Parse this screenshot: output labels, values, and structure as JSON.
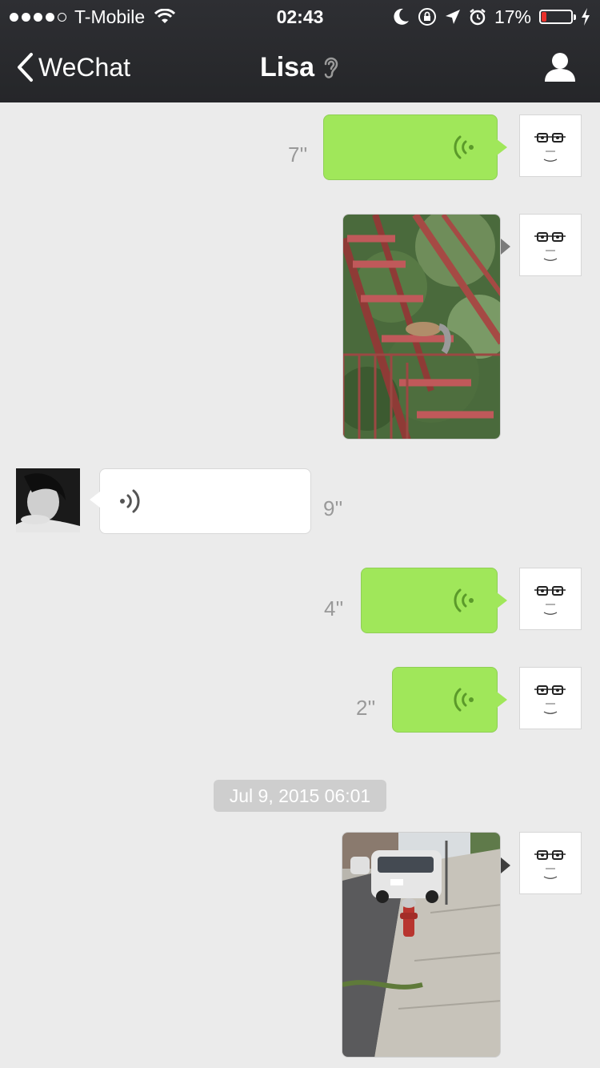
{
  "status_bar": {
    "carrier": "T-Mobile",
    "time": "02:43",
    "battery_percent": "17%",
    "battery_level": 0.17
  },
  "nav": {
    "back_label": "WeChat",
    "title": "Lisa"
  },
  "messages": [
    {
      "type": "voice",
      "sender": "me",
      "duration": "7''"
    },
    {
      "type": "image",
      "sender": "me",
      "image_icon": "fire-escape-squirrel-photo"
    },
    {
      "type": "voice",
      "sender": "Lisa",
      "duration": "9''"
    },
    {
      "type": "voice",
      "sender": "me",
      "duration": "4''"
    },
    {
      "type": "voice",
      "sender": "me",
      "duration": "2''"
    },
    {
      "type": "timestamp",
      "text": "Jul 9, 2015 06:01"
    },
    {
      "type": "image",
      "sender": "me",
      "image_icon": "street-hydrant-photo"
    }
  ],
  "colors": {
    "header_bg": "#2b2c30",
    "chat_bg": "#ebebeb",
    "bubble_me": "#a0e75a",
    "bubble_other": "#ffffff",
    "battery_low": "#e8302a"
  }
}
